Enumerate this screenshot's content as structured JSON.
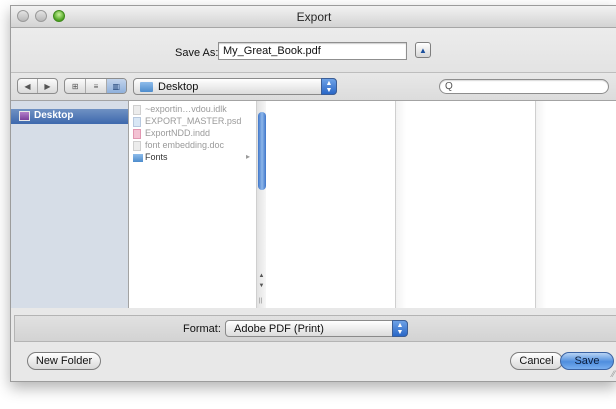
{
  "window": {
    "title": "Export"
  },
  "save_as": {
    "label": "Save As:",
    "value": "My_Great_Book.pdf",
    "expand_icon": "triangle-up-icon"
  },
  "toolbar": {
    "back_icon": "◀",
    "forward_icon": "▶",
    "view_icon_view": "⊞",
    "view_list": "≡",
    "view_column": "▥",
    "location": "Desktop",
    "search_placeholder": "",
    "search_glyph": "Q"
  },
  "sidebar": {
    "items": [
      {
        "label": "Desktop",
        "selected": true
      }
    ]
  },
  "files": [
    {
      "name": "~exportin…vdou.idlk",
      "type": "lock"
    },
    {
      "name": "EXPORT_MASTER.psd",
      "type": "psd"
    },
    {
      "name": "ExportNDD.indd",
      "type": "indd"
    },
    {
      "name": "font embedding.doc",
      "type": "doc"
    },
    {
      "name": "Fonts",
      "type": "folder",
      "chevron": "▸"
    }
  ],
  "format": {
    "label": "Format:",
    "value": "Adobe PDF (Print)"
  },
  "buttons": {
    "new_folder": "New Folder",
    "cancel": "Cancel",
    "save": "Save"
  },
  "colors": {
    "accent": "#3d68ad",
    "default_button": "#4f8ede",
    "sidebar_bg": "#d6dde7"
  }
}
